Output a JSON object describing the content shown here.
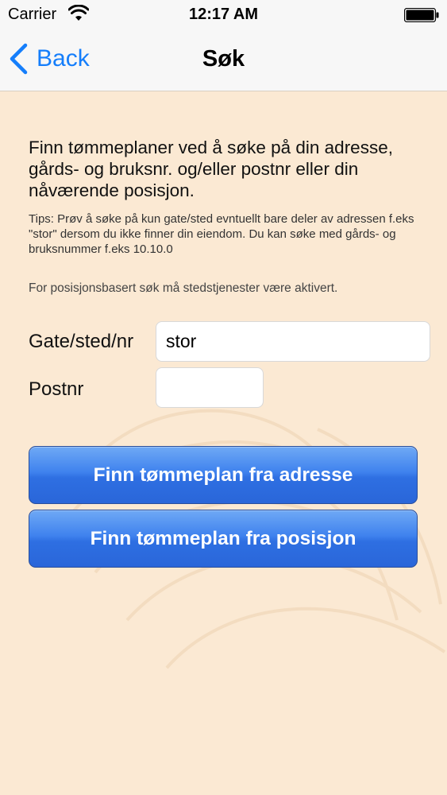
{
  "status_bar": {
    "carrier": "Carrier",
    "time": "12:17 AM",
    "icons": [
      "wifi-icon",
      "battery-icon"
    ]
  },
  "nav": {
    "back_label": "Back",
    "title": "Søk"
  },
  "content": {
    "intro": "Finn tømmeplaner ved å søke på din adresse, gårds- og bruksnr. og/eller postnr eller din nåværende posisjon.",
    "tips": "Tips: Prøv å søke på kun gate/sted evntuellt bare deler av adressen f.eks \"stor\" dersom du ikke finner din eiendom. Du kan søke med gårds- og bruksnummer f.eks 10.10.0",
    "location_note": "For posisjonsbasert søk må stedstjenester være aktivert."
  },
  "form": {
    "street_label": "Gate/sted/nr",
    "street_value": "stor",
    "postnr_label": "Postnr",
    "postnr_value": ""
  },
  "buttons": {
    "find_by_address": "Finn tømmeplan fra adresse",
    "find_by_position": "Finn tømmeplan fra posisjon"
  },
  "colors": {
    "background": "#fbe9d3",
    "accent": "#157efb",
    "button_blue": "#3f82ee"
  }
}
